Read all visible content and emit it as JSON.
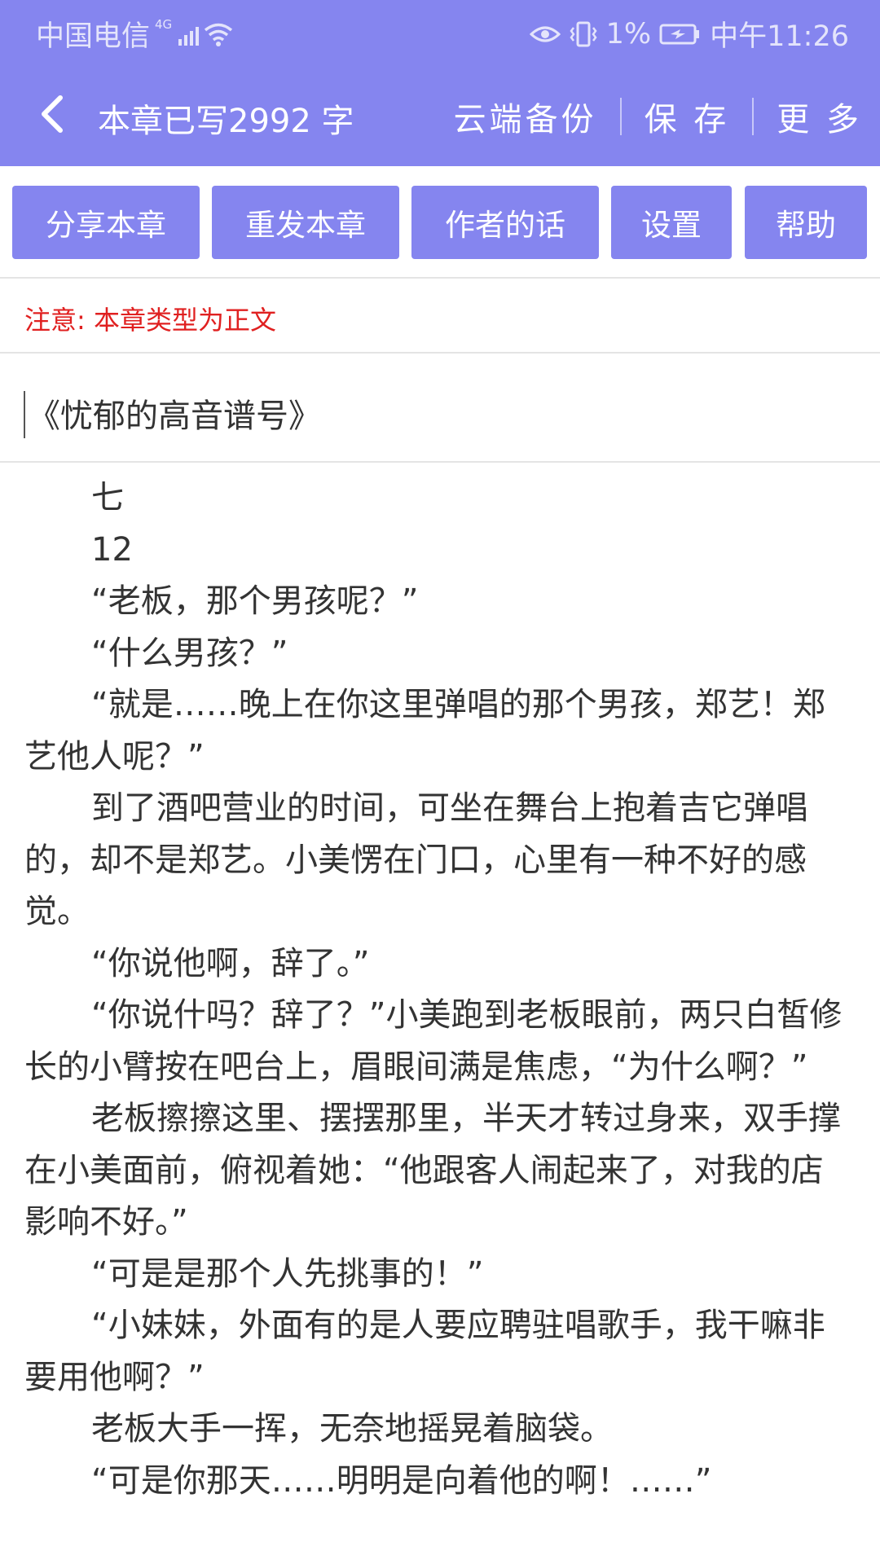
{
  "status_bar": {
    "carrier": "中国电信",
    "network": "4G",
    "battery": "1%",
    "time": "中午11:26",
    "icons": [
      "signal-icon",
      "wifi-icon",
      "eye-icon",
      "vibrate-icon",
      "battery-icon"
    ]
  },
  "header": {
    "chapter_count": "本章已写2992 字",
    "actions": [
      "云端备份",
      "保 存",
      "更 多"
    ]
  },
  "toolbar": {
    "buttons": [
      "分享本章",
      "重发本章",
      "作者的话",
      "设置",
      "帮助"
    ]
  },
  "notice": "注意: 本章类型为正文",
  "chapter_title": "《忧郁的高音谱号》",
  "paragraphs": [
    "七",
    "12",
    "“老板，那个男孩呢？”",
    "“什么男孩？”",
    "“就是……晚上在你这里弹唱的那个男孩，郑艺！郑艺他人呢？”",
    "到了酒吧营业的时间，可坐在舞台上抱着吉它弹唱的，却不是郑艺。小美愣在门口，心里有一种不好的感觉。",
    "“你说他啊，辞了。”",
    "“你说什吗？辞了？”小美跑到老板眼前，两只白皙修长的小臂按在吧台上，眉眼间满是焦虑，“为什么啊？”",
    "老板擦擦这里、摆摆那里，半天才转过身来，双手撑在小美面前，俯视着她：“他跟客人闹起来了，对我的店影响不好。”",
    "“可是是那个人先挑事的！”",
    "“小妹妹，外面有的是人要应聘驻唱歌手，我干嘛非要用他啊？”",
    "老板大手一挥，无奈地摇晃着脑袋。",
    "“可是你那天……明明是向着他的啊！……”"
  ],
  "colors": {
    "accent": "#8585ef",
    "notice": "#e02020",
    "text": "#333333",
    "divider": "#e4e4e4"
  }
}
